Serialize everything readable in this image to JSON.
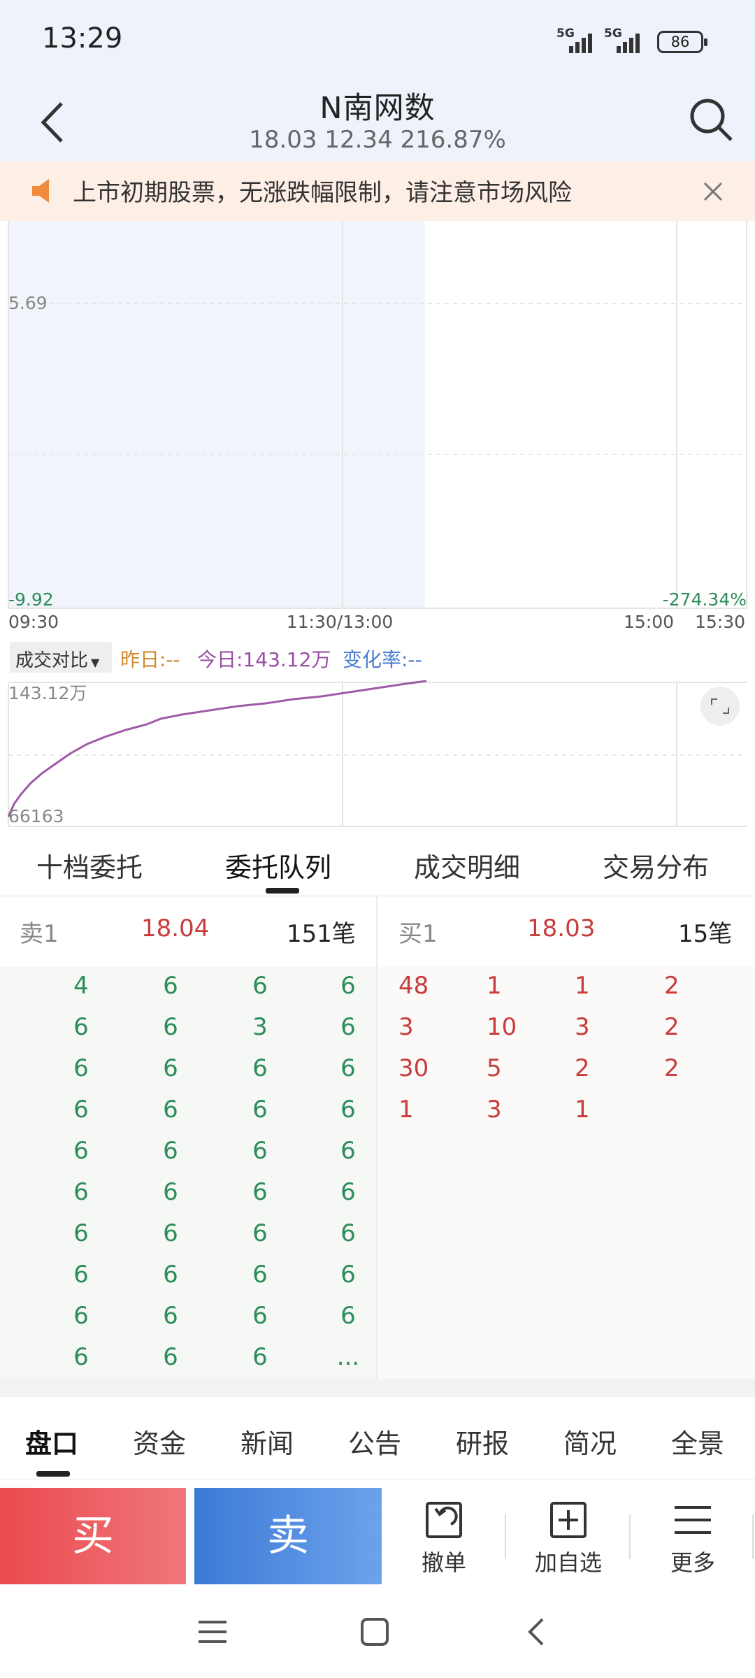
{
  "status": {
    "time": "13:29",
    "signal1": "5G",
    "signal2": "5G",
    "battery": "86"
  },
  "header": {
    "title": "N南网数",
    "subtitle": "18.03 12.34 216.87%"
  },
  "notice": {
    "text": "上市初期股票，无涨跌幅限制，请注意市场风险"
  },
  "price_chart": {
    "y_top_label": "5.69",
    "y_bottom_left": "-9.92",
    "y_bottom_right": "-274.34%",
    "x_labels": [
      "09:30",
      "11:30/13:00",
      "15:00",
      "15:30"
    ]
  },
  "volume_chart": {
    "selector": "成交对比",
    "yesterday": "昨日:--",
    "today": "今日:143.12万",
    "change": "变化率:--",
    "y_top": "143.12万",
    "y_bottom": "66163"
  },
  "tabs": [
    "十档委托",
    "委托队列",
    "成交明细",
    "交易分布"
  ],
  "active_tab": "委托队列",
  "queue": {
    "sell": {
      "label": "卖1",
      "price": "18.04",
      "count": "151笔"
    },
    "buy": {
      "label": "买1",
      "price": "18.03",
      "count": "15笔"
    },
    "sell_rows": [
      [
        "4",
        "6",
        "6",
        "6"
      ],
      [
        "6",
        "6",
        "3",
        "6"
      ],
      [
        "6",
        "6",
        "6",
        "6"
      ],
      [
        "6",
        "6",
        "6",
        "6"
      ],
      [
        "6",
        "6",
        "6",
        "6"
      ],
      [
        "6",
        "6",
        "6",
        "6"
      ],
      [
        "6",
        "6",
        "6",
        "6"
      ],
      [
        "6",
        "6",
        "6",
        "6"
      ],
      [
        "6",
        "6",
        "6",
        "6"
      ],
      [
        "6",
        "6",
        "6",
        "..."
      ]
    ],
    "buy_rows": [
      [
        "48",
        "1",
        "1",
        "2"
      ],
      [
        "3",
        "10",
        "3",
        "2"
      ],
      [
        "30",
        "5",
        "2",
        "2"
      ],
      [
        "1",
        "3",
        "1",
        ""
      ]
    ]
  },
  "bottom_tabs": [
    "盘口",
    "资金",
    "新闻",
    "公告",
    "研报",
    "简况",
    "全景"
  ],
  "actions": {
    "buy": "买",
    "sell": "卖",
    "cancel": "撤单",
    "watchlist": "加自选",
    "more": "更多"
  },
  "colors": {
    "up": "#c83c3c",
    "down": "#2e8c5a",
    "volume_line": "#a05aa8",
    "accent_blue": "#3b7ad8"
  }
}
